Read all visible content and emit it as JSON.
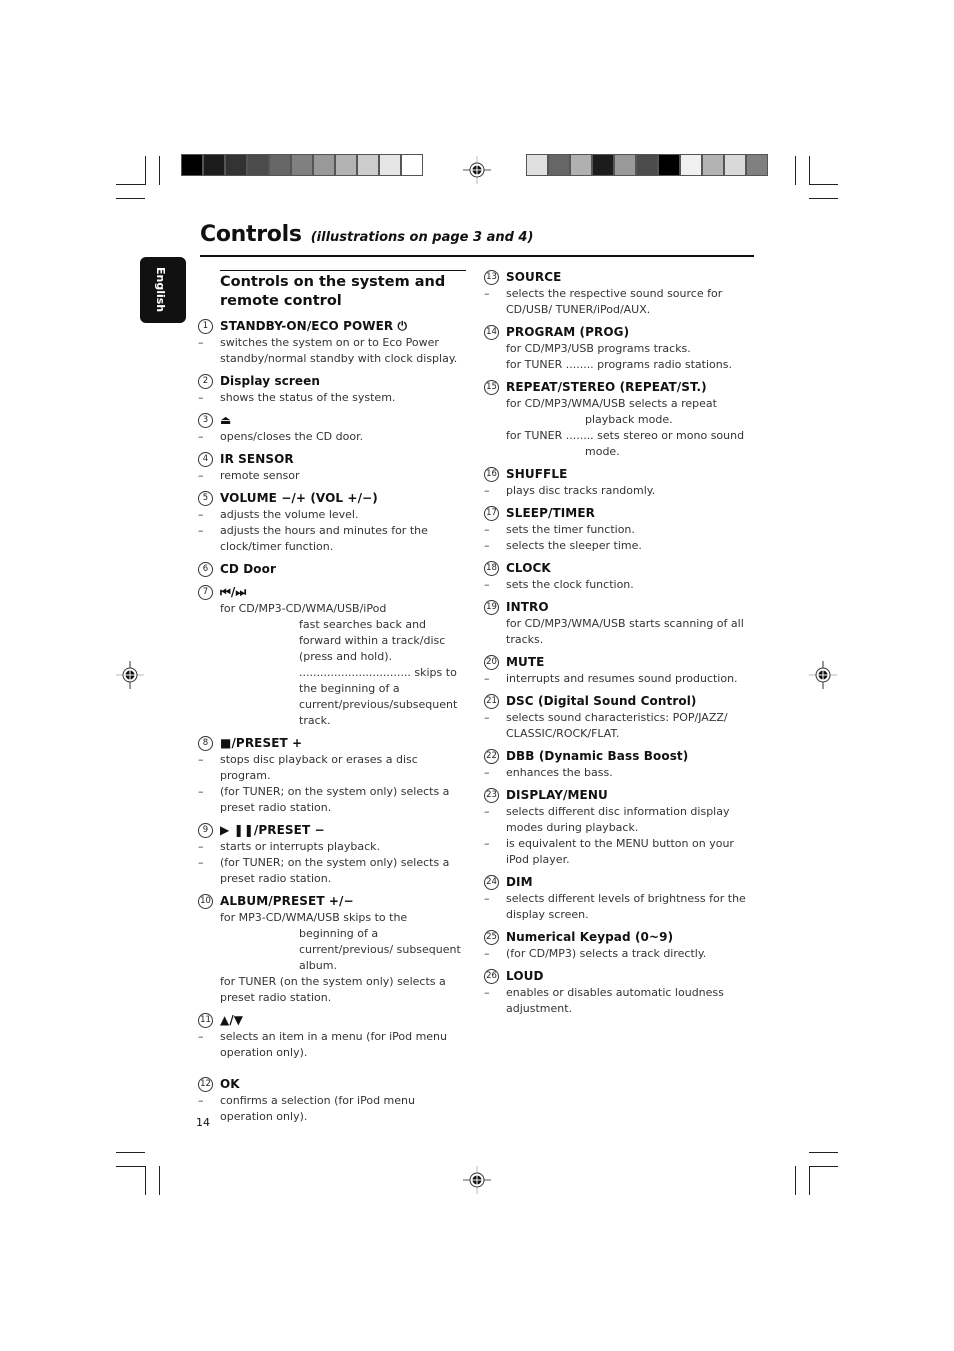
{
  "page": {
    "title": "Controls",
    "subtitle": "(illustrations on page 3 and 4)",
    "language_tab": "English",
    "page_number": "14"
  },
  "colors": {
    "left_bar": [
      "#000000",
      "#1c1c1c",
      "#333333",
      "#4b4b4b",
      "#666666",
      "#808080",
      "#999999",
      "#b3b3b3",
      "#cccccc",
      "#e6e6e6",
      "#ffffff"
    ],
    "right_bar": [
      "#e0e0e0",
      "#666666",
      "#b0b0b0",
      "#1c1c1c",
      "#999999",
      "#4b4b4b",
      "#000000",
      "#f0f0f0",
      "#b3b3b3",
      "#d9d9d9",
      "#808080"
    ]
  },
  "section": {
    "heading_line1": "Controls on the system and",
    "heading_line2": "remote control"
  },
  "items": [
    {
      "n": "1",
      "title": "STANDBY-ON/ECO POWER ⏻",
      "bullets": [
        "switches the system on or to Eco Power standby/normal standby with clock display."
      ]
    },
    {
      "n": "2",
      "title": "Display screen",
      "bullets": [
        "shows the status of the system."
      ]
    },
    {
      "n": "3",
      "title": "⏏",
      "bullets": [
        "opens/closes the CD door."
      ]
    },
    {
      "n": "4",
      "title": "IR SENSOR",
      "bullets": [
        "remote sensor"
      ]
    },
    {
      "n": "5",
      "title": "VOLUME −/+  (VOL +/−)",
      "bullets": [
        "adjusts the volume level.",
        "adjusts the hours and minutes for the clock/timer function."
      ]
    },
    {
      "n": "6",
      "title": "CD Door",
      "bullets": []
    },
    {
      "n": "7",
      "title": "⏮/⏭",
      "lines": [
        "for CD/MP3-CD/WMA/USB/iPod"
      ],
      "sub": [
        "fast searches back and forward within a track/disc (press and hold).",
        "................................ skips to the beginning of a current/previous/subsequent track."
      ]
    },
    {
      "n": "8",
      "title": "■/PRESET +",
      "bullets": [
        "stops disc playback or erases a disc program.",
        "(for TUNER; on the system only) selects a preset radio station."
      ]
    },
    {
      "n": "9",
      "title": "▶ ❚❚/PRESET −",
      "bullets": [
        "starts or interrupts playback.",
        "(for TUNER; on the system only) selects a preset radio station."
      ]
    },
    {
      "n": "10",
      "title": "ALBUM/PRESET +/−",
      "lines": [
        "for MP3-CD/WMA/USB        skips to the"
      ],
      "sub": [
        "beginning of a current/previous/ subsequent album."
      ],
      "lines2": [
        "for TUNER          (on the system only) selects a preset radio station."
      ]
    },
    {
      "n": "11",
      "title": "▲/▼",
      "bullets": [
        "selects an item in a menu (for iPod menu operation only)."
      ]
    },
    {
      "n": "12",
      "title": "OK",
      "bullets": [
        "confirms a selection (for iPod menu operation only)."
      ]
    },
    {
      "n": "13",
      "title": "SOURCE",
      "bullets": [
        "selects the respective sound source for CD/USB/ TUNER/iPod/AUX."
      ]
    },
    {
      "n": "14",
      "title": "PROGRAM (PROG)",
      "lines": [
        "for CD/MP3/USB  programs tracks.",
        "for TUNER ........ programs radio stations."
      ]
    },
    {
      "n": "15",
      "title": "REPEAT/STEREO (REPEAT/ST.)",
      "lines": [
        "for CD/MP3/WMA/USB        selects a repeat"
      ],
      "sub": [
        "playback mode."
      ],
      "lines2": [
        "for TUNER ........ sets stereo or mono sound"
      ],
      "sub2": [
        "mode."
      ]
    },
    {
      "n": "16",
      "title": "SHUFFLE",
      "bullets": [
        "plays disc tracks randomly."
      ]
    },
    {
      "n": "17",
      "title": "SLEEP/TIMER",
      "bullets": [
        "sets the timer function.",
        "selects the sleeper time."
      ]
    },
    {
      "n": "18",
      "title": "CLOCK",
      "bullets": [
        "sets the clock function."
      ]
    },
    {
      "n": "19",
      "title": "INTRO",
      "lines": [
        "for CD/MP3/WMA/USB        starts scanning of all tracks."
      ]
    },
    {
      "n": "20",
      "title": "MUTE",
      "bullets": [
        "interrupts and resumes sound production."
      ]
    },
    {
      "n": "21",
      "title": "DSC (Digital Sound Control)",
      "bullets": [
        "selects sound characteristics: POP/JAZZ/ CLASSIC/ROCK/FLAT."
      ]
    },
    {
      "n": "22",
      "title": "DBB (Dynamic Bass Boost)",
      "bullets": [
        "enhances the bass."
      ]
    },
    {
      "n": "23",
      "title": "DISPLAY/MENU",
      "bullets": [
        "selects different disc information display modes during playback.",
        "is equivalent to the MENU button on your iPod player."
      ]
    },
    {
      "n": "24",
      "title": "DIM",
      "bullets": [
        "selects different levels of brightness for the display screen."
      ]
    },
    {
      "n": "25",
      "title": "Numerical Keypad (0~9)",
      "bullets": [
        "(for CD/MP3) selects a track directly."
      ]
    },
    {
      "n": "26",
      "title": "LOUD",
      "bullets": [
        "enables or disables automatic loudness adjustment."
      ]
    }
  ]
}
